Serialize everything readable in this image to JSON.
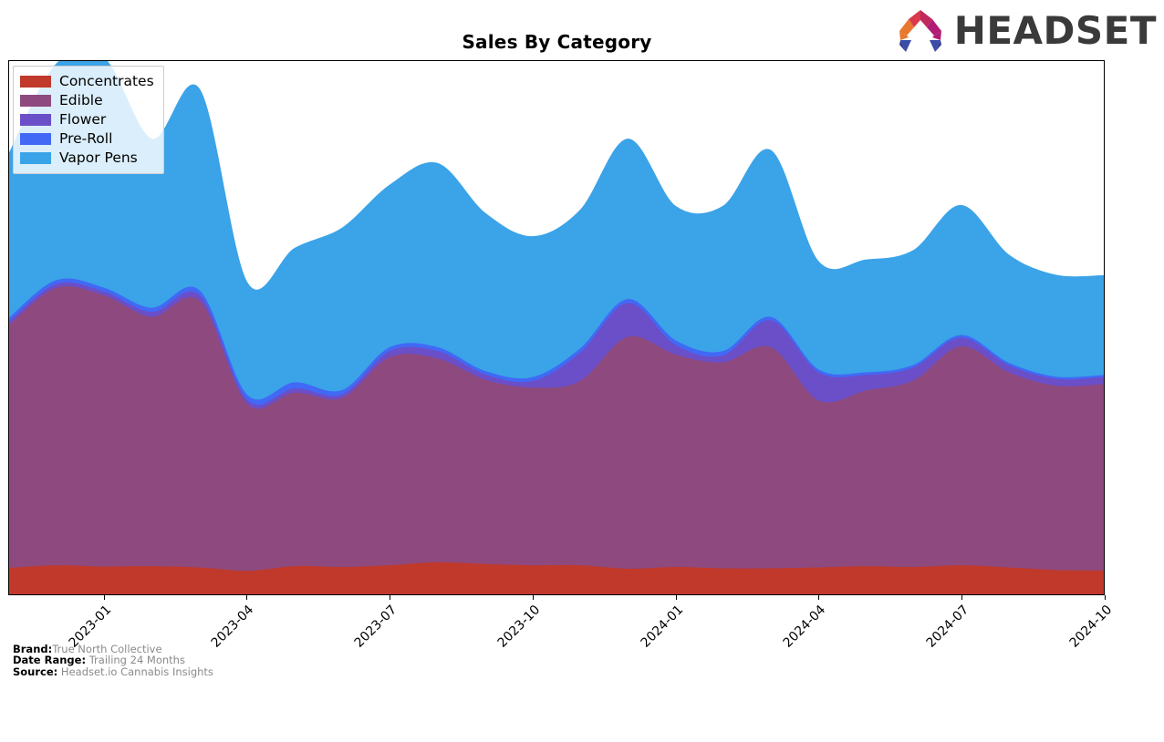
{
  "header": {
    "title": "Sales By Category",
    "logo": {
      "wordmark": "HEADSET",
      "icon_name": "headset-arch-logo",
      "colors": [
        "#E8782E",
        "#D93A4B",
        "#C1285E",
        "#B01C74",
        "#3A4DA8",
        "#2E3C8F"
      ]
    }
  },
  "legend": {
    "position": "upper-left",
    "items": [
      {
        "label": "Concentrates",
        "color": "#C0392B"
      },
      {
        "label": "Edible",
        "color": "#8E4A7E"
      },
      {
        "label": "Flower",
        "color": "#6B4FC8"
      },
      {
        "label": "Pre-Roll",
        "color": "#4169F5"
      },
      {
        "label": "Vapor Pens",
        "color": "#3BA3E8"
      }
    ]
  },
  "footer": {
    "rows": [
      {
        "key": "Brand:",
        "value": "True North Collective"
      },
      {
        "key": "Date Range:",
        "value": "Trailing 24 Months"
      },
      {
        "key": "Source:",
        "value": "Headset.io Cannabis Insights"
      }
    ]
  },
  "axis": {
    "x_ticks": [
      "2023-01",
      "2023-04",
      "2023-07",
      "2023-10",
      "2024-01",
      "2024-04",
      "2024-07",
      "2024-10"
    ],
    "y_ticks": [],
    "y_visible": false,
    "grid": false
  },
  "chart_data": {
    "type": "area",
    "stacked": true,
    "title": "Sales By Category",
    "xlabel": "",
    "ylabel": "",
    "grid": false,
    "legend_position": "upper-left",
    "x": [
      "2022-11",
      "2022-12",
      "2023-01",
      "2023-02",
      "2023-03",
      "2023-04",
      "2023-05",
      "2023-06",
      "2023-07",
      "2023-08",
      "2023-09",
      "2023-10",
      "2023-11",
      "2023-12",
      "2024-01",
      "2024-02",
      "2024-03",
      "2024-04",
      "2024-05",
      "2024-06",
      "2024-07",
      "2024-08",
      "2024-09",
      "2024-10"
    ],
    "series": [
      {
        "name": "Concentrates",
        "color": "#C0392B",
        "values": [
          6.0,
          6.6,
          6.3,
          6.4,
          6.1,
          5.3,
          6.4,
          6.2,
          6.6,
          7.3,
          6.9,
          6.6,
          6.6,
          5.8,
          6.2,
          5.9,
          5.9,
          6.1,
          6.4,
          6.2,
          6.6,
          6.1,
          5.5,
          5.4
        ]
      },
      {
        "name": "Edible",
        "color": "#8E4A7E",
        "values": [
          56.0,
          64.0,
          62.5,
          57.5,
          61.5,
          38.5,
          40.0,
          39.0,
          48.0,
          47.0,
          42.5,
          41.0,
          42.5,
          53.5,
          49.0,
          47.5,
          51.0,
          38.5,
          40.5,
          43.0,
          50.5,
          45.0,
          42.5,
          43.0
        ]
      },
      {
        "name": "Flower",
        "color": "#6B4FC8",
        "values": [
          0.8,
          0.9,
          0.9,
          1.1,
          1.3,
          0.9,
          1.0,
          0.8,
          1.4,
          1.7,
          1.2,
          1.5,
          6.5,
          7.8,
          2.2,
          1.6,
          6.2,
          6.5,
          3.6,
          3.0,
          2.0,
          1.6,
          1.6,
          1.6
        ]
      },
      {
        "name": "Pre-Roll",
        "color": "#4169F5",
        "values": [
          0.9,
          0.9,
          0.9,
          1.0,
          1.1,
          1.2,
          1.4,
          1.0,
          0.9,
          0.9,
          0.8,
          0.9,
          1.0,
          0.9,
          1.1,
          1.0,
          0.8,
          0.7,
          0.6,
          0.6,
          0.6,
          0.6,
          0.5,
          0.5
        ]
      },
      {
        "name": "Vapor Pens",
        "color": "#3BA3E8",
        "values": [
          38.0,
          50.0,
          53.0,
          39.0,
          46.5,
          26.0,
          31.0,
          37.5,
          37.5,
          42.5,
          36.5,
          32.5,
          32.0,
          37.0,
          31.0,
          33.5,
          38.5,
          25.0,
          26.0,
          26.5,
          30.0,
          25.0,
          23.5,
          23.0
        ]
      }
    ],
    "ylim": [
      0,
      123
    ],
    "note": "y-axis unlabeled; top of first peak is clipped by the plot frame"
  }
}
